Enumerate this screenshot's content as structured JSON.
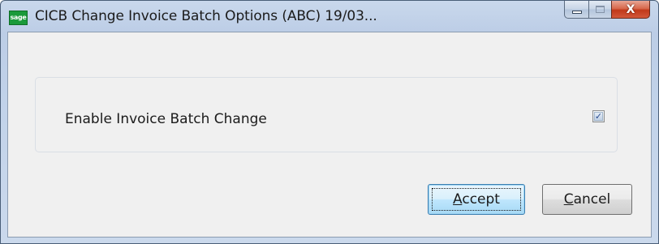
{
  "window": {
    "app_icon_text": "sage",
    "title": "CICB Change Invoice Batch Options (ABC) 19/03...",
    "controls": {
      "minimize_icon": "minimize-icon",
      "maximize_icon": "maximize-icon",
      "close_icon": "close-icon",
      "close_glyph": "X"
    }
  },
  "options": {
    "enable_invoice_batch_change": {
      "label": "Enable Invoice Batch Change",
      "checked": true,
      "check_glyph": "✓"
    }
  },
  "buttons": {
    "accept": {
      "mnemonic": "A",
      "rest": "ccept"
    },
    "cancel": {
      "mnemonic": "C",
      "rest": "ancel"
    }
  },
  "colors": {
    "app_icon": "#1a9a3a",
    "close_button": "#c1391a",
    "default_button_border": "#3c7fb1"
  }
}
